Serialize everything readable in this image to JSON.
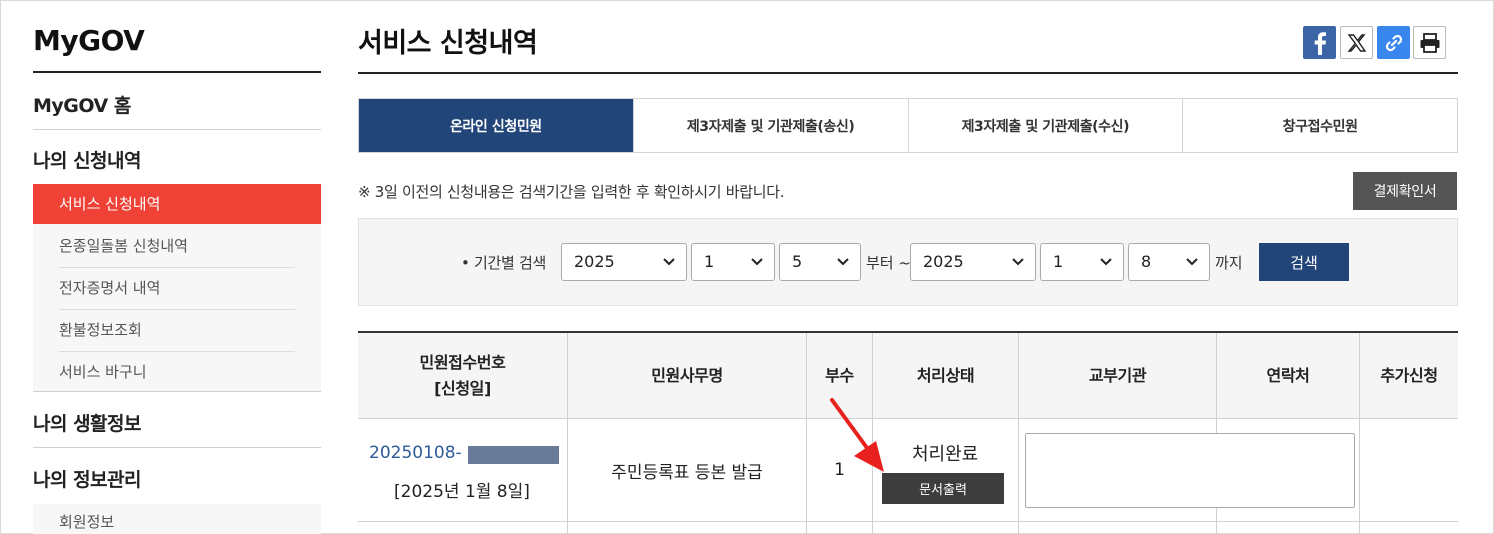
{
  "sidebar": {
    "title": "MyGOV",
    "home": "MyGOV 홈",
    "section_requests": "나의 신청내역",
    "items": [
      {
        "label": "서비스 신청내역",
        "active": true
      },
      {
        "label": "온종일돌봄 신청내역",
        "active": false
      },
      {
        "label": "전자증명서 내역",
        "active": false
      },
      {
        "label": "환불정보조회",
        "active": false
      },
      {
        "label": "서비스 바구니",
        "active": false
      }
    ],
    "section_life": "나의 생활정보",
    "section_info": "나의 정보관리",
    "info_items": [
      {
        "label": "회원정보"
      }
    ]
  },
  "header": {
    "title": "서비스 신청내역",
    "share_icons": [
      "facebook-icon",
      "x-icon",
      "link-icon",
      "print-icon"
    ]
  },
  "tabs": [
    {
      "label": "온라인 신청민원",
      "active": true
    },
    {
      "label": "제3자제출 및 기관제출(송신)",
      "active": false
    },
    {
      "label": "제3자제출 및 기관제출(수신)",
      "active": false
    },
    {
      "label": "창구접수민원",
      "active": false
    }
  ],
  "notice": "※ 3일 이전의 신청내용은 검색기간을 입력한 후 확인하시기 바랍니다.",
  "confirm_button": "결제확인서",
  "search": {
    "label": "• 기간별 검색",
    "from_year": "2025",
    "from_month": "1",
    "from_day": "5",
    "from_word": "부터 ~",
    "to_year": "2025",
    "to_month": "1",
    "to_day": "8",
    "to_word": "까지",
    "button": "검색"
  },
  "table": {
    "headers": [
      "민원접수번호\n[신청일]",
      "민원사무명",
      "부수",
      "처리상태",
      "교부기관",
      "연락처",
      "추가신청"
    ],
    "rows": [
      {
        "receipt_no": "20250108-",
        "date": "[2025년 1월 8일]",
        "name": "주민등록표 등본 발급",
        "copies": "1",
        "status": "처리완료",
        "print_button": "문서출력",
        "agency": "",
        "contact": "",
        "extra": ""
      }
    ]
  },
  "colors": {
    "active_tab": "#224579",
    "sidebar_active": "#ef4136",
    "arrow": "#e8211e",
    "masked_block": "#6a7b99"
  }
}
